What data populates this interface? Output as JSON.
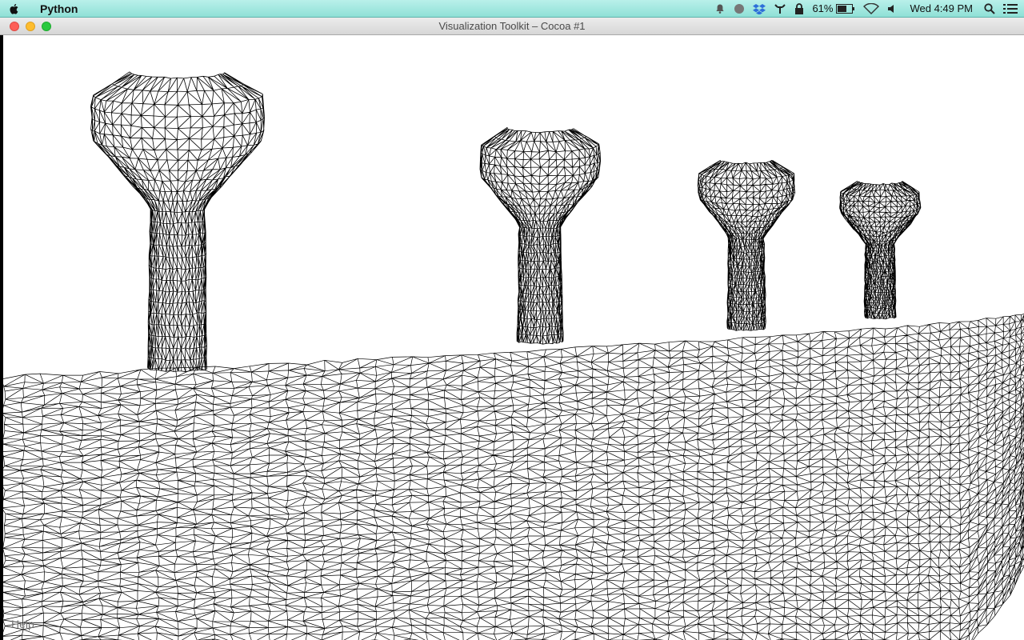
{
  "menubar": {
    "app_name": "Python",
    "battery": "61%",
    "clock": "Wed 4:49 PM",
    "icons": [
      "apple-icon",
      "notification-bell-icon",
      "circle-icon",
      "dropbox-icon",
      "network-icon",
      "lock-icon",
      "battery-icon",
      "wifi-icon",
      "volume-icon",
      "search-icon",
      "list-icon"
    ]
  },
  "window": {
    "title": "Visualization Toolkit – Cocoa #1"
  },
  "viewport": {
    "help_label": "Help",
    "background": "#ffffff",
    "wire_color": "#000000"
  }
}
